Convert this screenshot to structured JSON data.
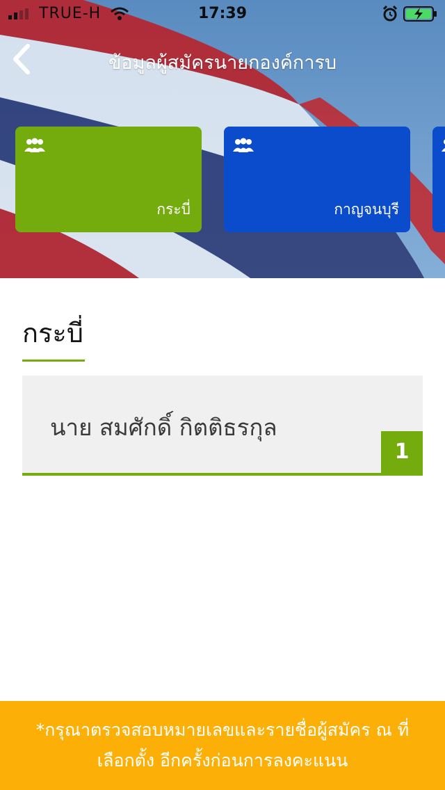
{
  "status_bar": {
    "carrier": "TRUE-H",
    "time": "17:39"
  },
  "nav": {
    "title": "ข้อมูลผู้สมัครนายกองค์การบ"
  },
  "cards": [
    {
      "label": "กระบี่",
      "color": "#74ac0e",
      "icon": "people-group-icon"
    },
    {
      "label": "กาญจนบุรี",
      "color": "#0b4ccc",
      "icon": "people-group-icon"
    }
  ],
  "section": {
    "title": "กระบี่"
  },
  "candidates": [
    {
      "name": "นาย สมศักดิ์ กิตติธรกุล",
      "number": "1"
    }
  ],
  "notice": {
    "line1": "*กรุณาตรวจสอบหมายเลขและรายชื่อผู้สมัคร ณ ที่",
    "line2": "เลือกตั้ง อีกครั้งก่อนการลงคะแนน"
  },
  "colors": {
    "accent_green": "#74ac0e",
    "card_blue": "#0b4ccc",
    "notice_orange": "#fcaf06"
  }
}
